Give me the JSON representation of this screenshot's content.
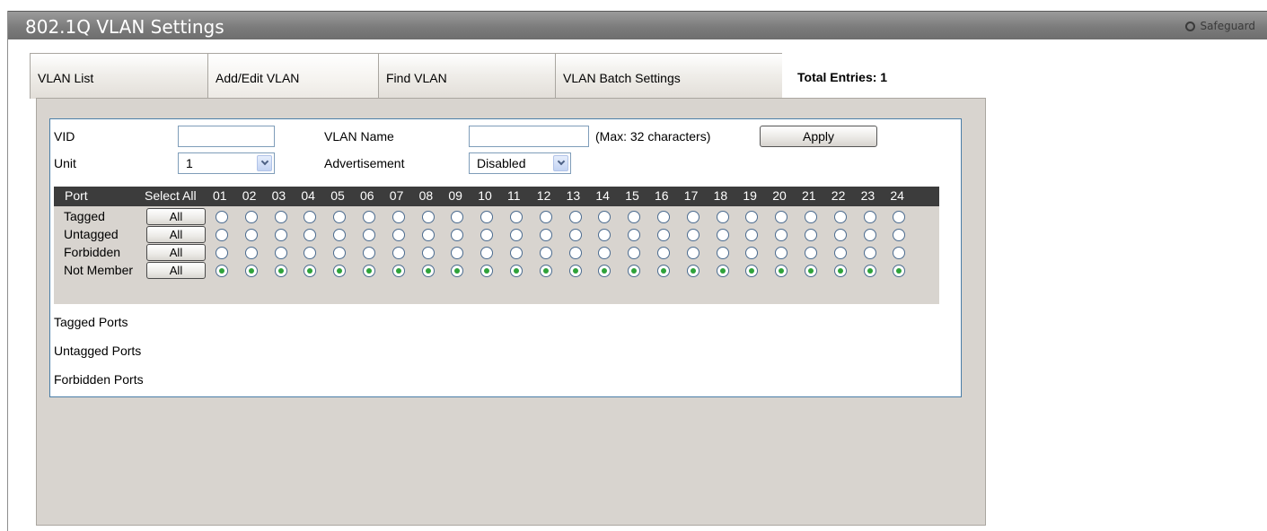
{
  "header": {
    "title": "802.1Q VLAN Settings",
    "safeguard_label": "Safeguard"
  },
  "tabs": [
    {
      "label": "VLAN List"
    },
    {
      "label": "Add/Edit VLAN"
    },
    {
      "label": "Find VLAN"
    },
    {
      "label": "VLAN Batch Settings"
    }
  ],
  "total_entries": "Total Entries: 1",
  "form": {
    "vid_label": "VID",
    "vid_value": "",
    "vlan_name_label": "VLAN Name",
    "vlan_name_value": "",
    "max_hint": "(Max: 32 characters)",
    "apply_label": "Apply",
    "unit_label": "Unit",
    "unit_value": "1",
    "advertisement_label": "Advertisement",
    "advertisement_value": "Disabled"
  },
  "port_table": {
    "port_header": "Port",
    "select_all_header": "Select All",
    "ports": [
      "01",
      "02",
      "03",
      "04",
      "05",
      "06",
      "07",
      "08",
      "09",
      "10",
      "11",
      "12",
      "13",
      "14",
      "15",
      "16",
      "17",
      "18",
      "19",
      "20",
      "21",
      "22",
      "23",
      "24"
    ],
    "rows": [
      {
        "label": "Tagged",
        "all_label": "All",
        "selected": false
      },
      {
        "label": "Untagged",
        "all_label": "All",
        "selected": false
      },
      {
        "label": "Forbidden",
        "all_label": "All",
        "selected": false
      },
      {
        "label": "Not Member",
        "all_label": "All",
        "selected": true
      }
    ]
  },
  "summary": {
    "tagged_ports": "Tagged Ports",
    "untagged_ports": "Untagged Ports",
    "forbidden_ports": "Forbidden Ports"
  }
}
